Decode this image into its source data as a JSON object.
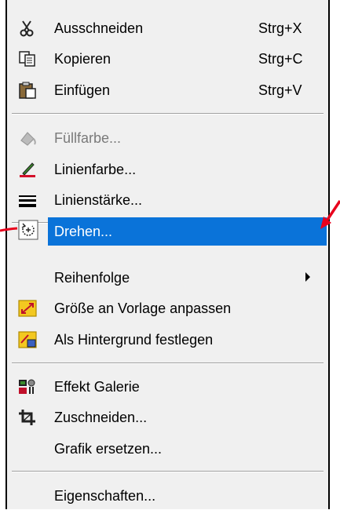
{
  "menu": {
    "items": [
      {
        "label": "Ausschneiden",
        "shortcut": "Strg+X",
        "icon": "scissors-icon"
      },
      {
        "label": "Kopieren",
        "shortcut": "Strg+C",
        "icon": "copy-icon"
      },
      {
        "label": "Einfügen",
        "shortcut": "Strg+V",
        "icon": "paste-icon"
      },
      {
        "label": "Füllfarbe...",
        "icon": "fill-color-icon",
        "disabled": true
      },
      {
        "label": "Linienfarbe...",
        "icon": "line-color-icon"
      },
      {
        "label": "Linienstärke...",
        "icon": "line-width-icon"
      },
      {
        "label": "Drehen...",
        "icon": "rotate-icon",
        "highlighted": true
      },
      {
        "label": "Reihenfolge",
        "submenu": true
      },
      {
        "label": "Größe an Vorlage anpassen",
        "icon": "resize-to-template-icon"
      },
      {
        "label": "Als Hintergrund festlegen",
        "icon": "set-background-icon"
      },
      {
        "label": "Effekt Galerie",
        "icon": "effects-gallery-icon"
      },
      {
        "label": "Zuschneiden...",
        "icon": "crop-icon"
      },
      {
        "label": "Grafik ersetzen..."
      },
      {
        "label": "Eigenschaften..."
      }
    ]
  },
  "colors": {
    "highlight": "#0a73d9",
    "annotation_arrow": "#e8001c"
  }
}
